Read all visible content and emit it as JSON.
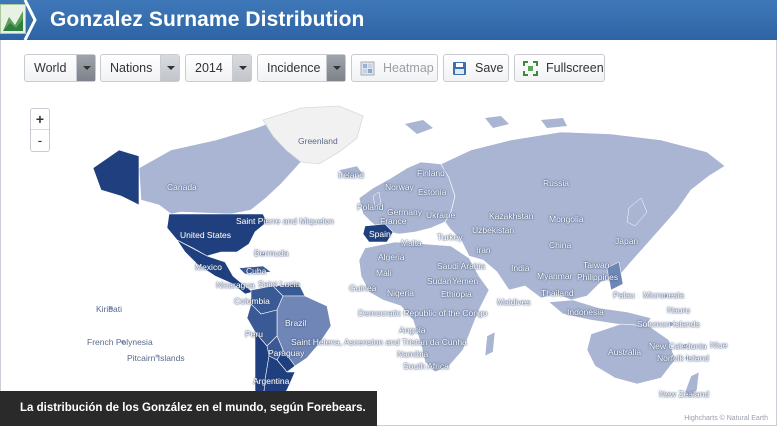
{
  "header": {
    "title": "Gonzalez Surname Distribution"
  },
  "toolbar": {
    "region_select": {
      "value": "World"
    },
    "level_select": {
      "value": "Nations"
    },
    "year_select": {
      "value": "2014"
    },
    "metric_select": {
      "value": "Incidence"
    },
    "heatmap_label": "Heatmap",
    "save_label": "Save",
    "fullscreen_label": "Fullscreen",
    "icons": [
      "heatmap-icon",
      "save-icon",
      "fullscreen-icon"
    ]
  },
  "map": {
    "zoom_in": "+",
    "zoom_out": "-",
    "colors": {
      "highest": "#1f3f7e",
      "high": "#3a5a96",
      "medium": "#6f86b6",
      "low": "#a9b5d2",
      "none": "#f1f1f1"
    },
    "labels": [
      "Greenland",
      "Finland",
      "Ireland",
      "Canada",
      "Norway",
      "Estonia",
      "Russia",
      "Poland",
      "Germany",
      "Ukraine",
      "Kazakhstan",
      "Mongolia",
      "France",
      "Saint Pierre and Miquelon",
      "Uzbekistan",
      "United States",
      "Spain",
      "Turkey",
      "Japan",
      "Malta",
      "Iran",
      "China",
      "Bermuda",
      "Algeria",
      "Mexico",
      "Cuba",
      "Saudi Arabia",
      "India",
      "Taiwan",
      "Mali",
      "Myanmar",
      "Philippines",
      "Sudan",
      "Yemen",
      "Nicaragua",
      "Saint Lucia",
      "Guinea",
      "Nigeria",
      "Ethiopia",
      "Thailand",
      "Palau",
      "Micronesia",
      "Colombia",
      "Maldives",
      "Nauru",
      "Kiribati",
      "Brazil",
      "Democratic Republic of the Congo",
      "Indonesia",
      "Solomon Islands",
      "Peru",
      "Angola",
      "French Polynesia",
      "Saint Helena, Ascension and Tristan da Cunha",
      "New Caledonia",
      "Niue",
      "Paraguay",
      "Namibia",
      "Australia",
      "Pitcairn Islands",
      "South Africa",
      "Norfolk Island",
      "Argentina",
      "New Zealand"
    ],
    "credit": "Highcharts © Natural Earth"
  },
  "caption": "La distribución de los González en el mundo, según Forebears."
}
